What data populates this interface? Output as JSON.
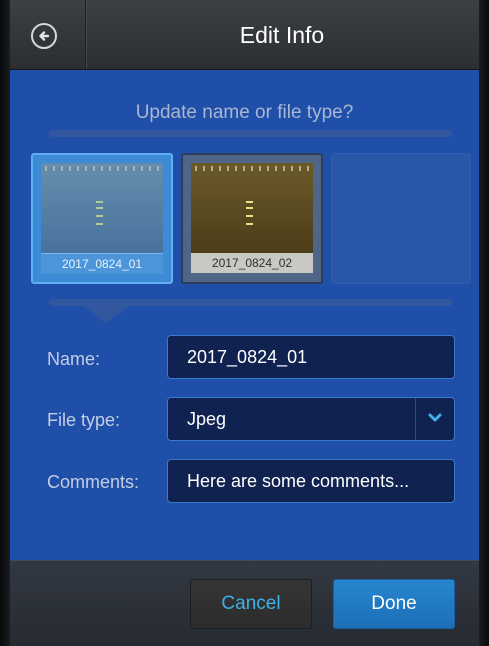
{
  "header": {
    "title": "Edit Info",
    "back_icon": "back-arrow-circle-icon"
  },
  "prompt": "Update name or file type?",
  "thumbnails": [
    {
      "label": "2017_0824_01",
      "selected": true
    },
    {
      "label": "2017_0824_02",
      "selected": false
    }
  ],
  "form": {
    "name_label": "Name:",
    "name_value": "2017_0824_01",
    "filetype_label": "File type:",
    "filetype_value": "Jpeg",
    "comments_label": "Comments:",
    "comments_value": "Here are some comments..."
  },
  "footer": {
    "cancel_label": "Cancel",
    "done_label": "Done"
  },
  "colors": {
    "background": "#1f4fa8",
    "accent": "#3fb0e8",
    "done_button": "#2380c8"
  }
}
